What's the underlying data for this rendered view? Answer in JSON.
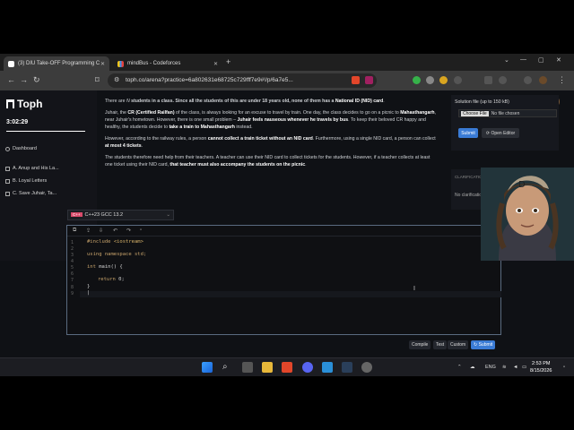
{
  "browser": {
    "tabs": [
      {
        "label": "(3) DIU Take-OFF Programming C",
        "active": true
      },
      {
        "label": "mindBus - Codeforces",
        "active": false
      }
    ],
    "url": "toph.co/arena?practice=6a802631e68725c729fff7e9#!/p/6a7e5..."
  },
  "sidebar": {
    "logo": "Toph",
    "timer": "3:02:29",
    "items": [
      {
        "label": "Dashboard",
        "icon": "dashboard-icon"
      },
      {
        "label": "A. Anup and His La...",
        "icon": "checkbox-icon"
      },
      {
        "label": "B. Loyal Letters",
        "icon": "checkbox-icon"
      },
      {
        "label": "C. Save Juhair, Ta...",
        "icon": "checkbox-icon"
      }
    ]
  },
  "problem": {
    "p1_a": "There are ",
    "p1_n": "N",
    "p1_b": " students in a class. Since all the students of this are under 18 years old, none of them has a ",
    "p1_c": "National ID (NID) card",
    "p1_d": ".",
    "p2_a": "Juhair, the ",
    "p2_b": "CR (Certified Railfan)",
    "p2_c": " of the class, is always looking for an excuse to travel by train. One day, the class decides to go on a picnic to ",
    "p2_d": "Mahasthangarh",
    "p2_e": ", near Juhair's hometown. However, there is one small problem – ",
    "p2_f": "Juhair feels nauseous whenever he travels by bus",
    "p2_g": ". To keep their beloved CR happy and healthy, the students decide to ",
    "p2_h": "take a train to Mahasthangarh",
    "p2_i": " instead.",
    "p3_a": "However, according to the railway rules, a person ",
    "p3_b": "cannot collect a train ticket without an NID card",
    "p3_c": ". Furthermore, using a single NID card, a person can collect ",
    "p3_d": "at most 4 tickets",
    "p3_e": ".",
    "p4_a": "The students therefore need help from their teachers. A teacher can use their NID card to collect tickets for the students. However, if a teacher collects at least one ticket using their NID card, ",
    "p4_b": "that teacher must also accompany the students on the picnic",
    "p4_c": "."
  },
  "submission": {
    "label": "Solution file (up to 150 kB)",
    "choose_label": "Choose File",
    "no_file": "No file chosen",
    "submit_label": "Submit",
    "editor_label": "Open Editor",
    "clar_title": "CLARIFICATIONS",
    "clar_text": "No clarification"
  },
  "editor": {
    "language_badge": "C++",
    "language": "C++23 GCC 13.2",
    "lines": [
      "1",
      "2",
      "3",
      "4",
      "5",
      "6",
      "7",
      "8",
      "9"
    ],
    "code": {
      "l1_kw": "#include ",
      "l1_inc": "<iostream>",
      "l3": "using namespace std;",
      "l5_kw": "int",
      "l5_rest": " main() {",
      "l7_kw": "return",
      "l7_rest": " 0;",
      "l8": "}",
      "l9": "|"
    },
    "buttons": {
      "compile": "Compile",
      "test": "Test",
      "custom": "Custom",
      "submit": "Submit"
    }
  },
  "taskbar": {
    "lang": "ENG",
    "time": "2:53 PM",
    "date": "8/15/2026"
  }
}
